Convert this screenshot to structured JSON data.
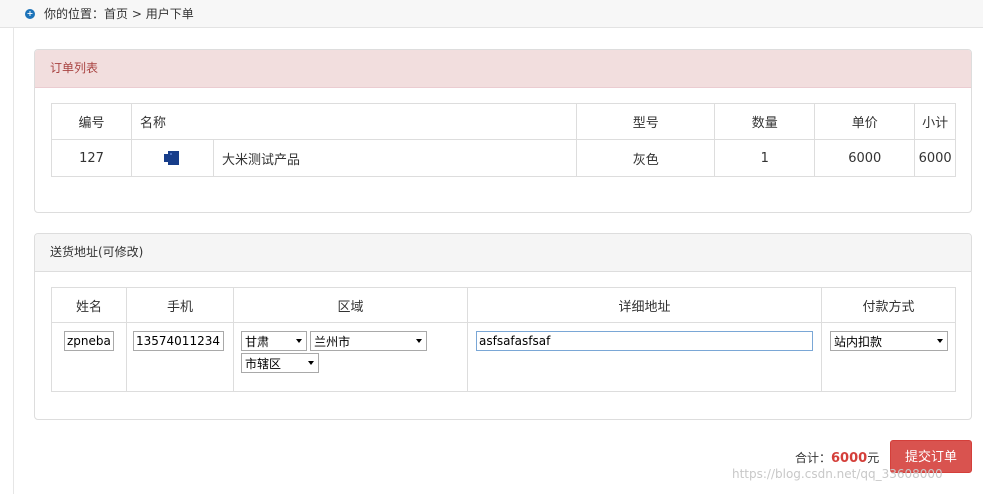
{
  "breadcrumb": {
    "icon": "info-circle-icon",
    "prefix": "你的位置：",
    "home": "首页",
    "separator": " > ",
    "current": "用户下单"
  },
  "orders_panel": {
    "title": "订单列表",
    "headers": [
      "编号",
      "名称",
      "型号",
      "数量",
      "单价",
      "小计"
    ],
    "rows": [
      {
        "id": "127",
        "thumb_icon": "product-thumbnail",
        "name": "大米测试产品",
        "model": "灰色",
        "qty": "1",
        "price": "6000",
        "subtotal": "6000"
      }
    ]
  },
  "address_panel": {
    "title": "送货地址(可修改)",
    "headers": [
      "姓名",
      "手机",
      "区域",
      "详细地址",
      "付款方式"
    ],
    "name_value": "zpnebai",
    "phone_value": "13574011234",
    "province": "甘肃",
    "city": "兰州市",
    "district": "市辖区",
    "detail_value": "asfsafasfsaf",
    "payment": "站内扣款"
  },
  "footer": {
    "total_label": "合计：",
    "total_value": "6000",
    "total_unit": "元",
    "submit_label": "提交订单",
    "watermark": "https://blog.csdn.net/qq_33608000"
  },
  "colors": {
    "danger": "#d9534f",
    "danger_bg": "#f2dede",
    "danger_text": "#a94442",
    "link_blue": "#1c73b9"
  }
}
